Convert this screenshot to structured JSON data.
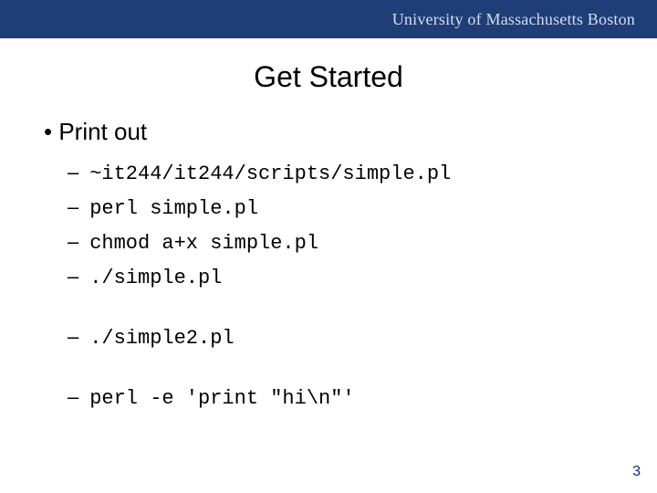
{
  "header": {
    "university": "University of Massachusetts Boston"
  },
  "title": "Get Started",
  "bullet1": "Print out",
  "groupA": [
    "~it244/it244/scripts/simple.pl",
    "perl simple.pl",
    "chmod a+x simple.pl",
    "./simple.pl"
  ],
  "groupB": [
    "./simple2.pl"
  ],
  "groupC": [
    "perl -e 'print \"hi\\n\"'"
  ],
  "pageNumber": "3"
}
